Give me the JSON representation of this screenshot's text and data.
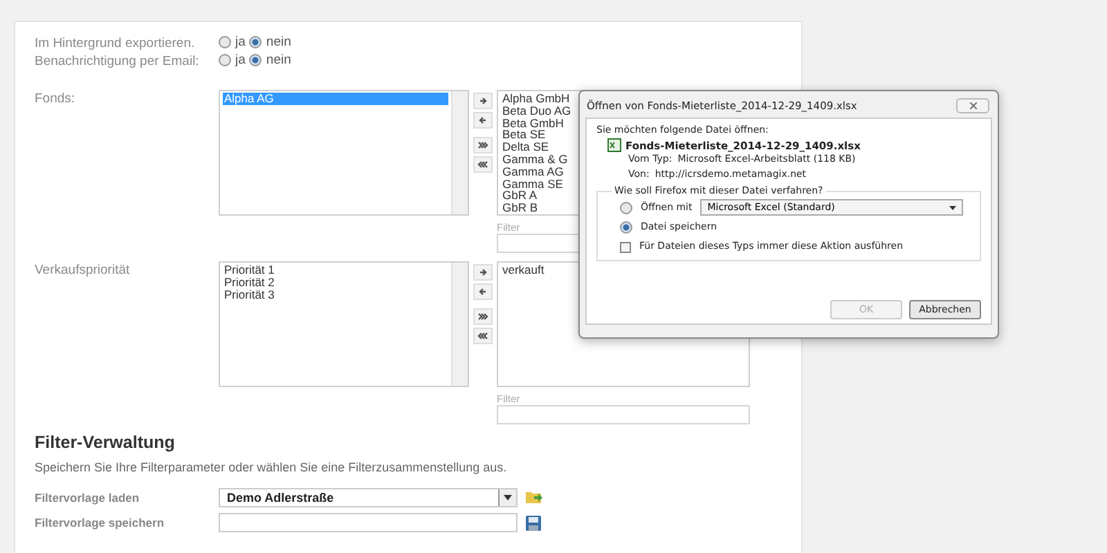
{
  "export_options": [
    {
      "label": "Im Hintergrund exportieren.",
      "options": [
        {
          "label": "ja",
          "selected": false
        },
        {
          "label": "nein",
          "selected": true
        }
      ]
    },
    {
      "label": "Benachrichtigung per Email:",
      "options": [
        {
          "label": "ja",
          "selected": false
        },
        {
          "label": "nein",
          "selected": true
        }
      ]
    }
  ],
  "pickers": [
    {
      "label": "Fonds:",
      "available": [
        {
          "label": "Alpha AG",
          "selected": true
        }
      ],
      "chosen": [
        "Alpha GmbH",
        "Beta Duo AG",
        "Beta GmbH",
        "Beta SE",
        "Delta SE",
        "Gamma & G",
        "Gamma AG",
        "Gamma SE",
        "GbR A",
        "GbR B"
      ],
      "filter_label": "Filter"
    },
    {
      "label": "Verkaufspriorität",
      "available": [
        {
          "label": "Priorität 1",
          "selected": false
        },
        {
          "label": "Priorität 2",
          "selected": false
        },
        {
          "label": "Priorität 3",
          "selected": false
        }
      ],
      "chosen": [
        "verkauft"
      ],
      "filter_label": "Filter"
    }
  ],
  "filter_management": {
    "title": "Filter-Verwaltung",
    "description": "Speichern Sie Ihre Filterparameter oder wählen Sie eine Filterzusammenstellung aus.",
    "rows": [
      {
        "kind": "select",
        "label": "Filtervorlage laden",
        "value": "Demo Adlerstraße"
      },
      {
        "kind": "input",
        "label": "Filtervorlage speichern"
      }
    ]
  },
  "dialog": {
    "title": "Öffnen von Fonds-Mieterliste_2014-12-29_1409.xlsx",
    "intro": "Sie möchten folgende Datei öffnen:",
    "file_name": "Fonds-Mieterliste_2014-12-29_1409.xlsx",
    "details": [
      {
        "key": "Vom Typ:",
        "value": "Microsoft Excel-Arbeitsblatt (118 KB)"
      },
      {
        "key": "Von:",
        "value": "http://icrsdemo.metamagix.net"
      }
    ],
    "group_title": "Wie soll Firefox mit dieser Datei verfahren?",
    "actions": [
      {
        "kind": "open_with",
        "label": "Öffnen mit",
        "app": "Microsoft Excel (Standard)",
        "selected": false
      },
      {
        "kind": "save",
        "label": "Datei speichern",
        "selected": true
      }
    ],
    "remember": {
      "label": "Für Dateien dieses Typs immer diese Aktion ausführen",
      "checked": false
    },
    "buttons": [
      {
        "label": "OK",
        "disabled": true
      },
      {
        "label": "Abbrechen",
        "disabled": false
      }
    ]
  }
}
